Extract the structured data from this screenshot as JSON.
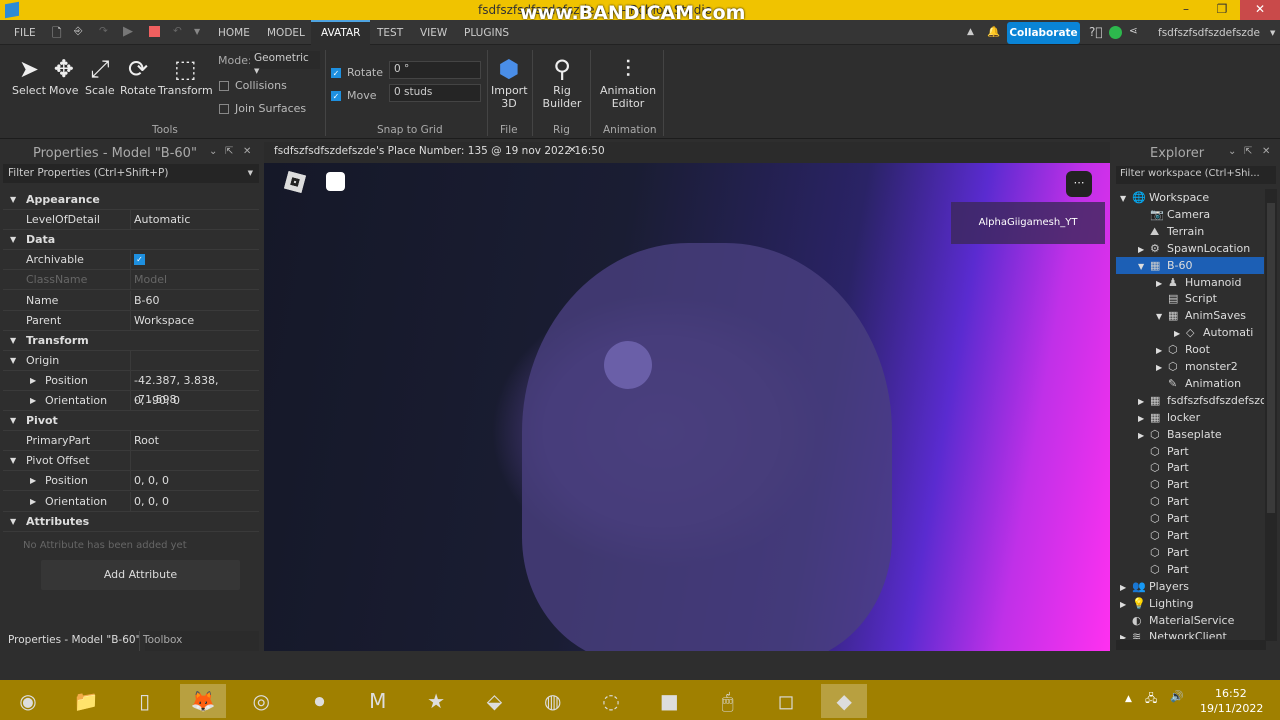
{
  "window": {
    "title": "fsdfszfsdfszdefszde - ... - Roblox Studio",
    "watermark": "www.BANDICAM.com",
    "min": "–",
    "max": "❐",
    "close": "✕"
  },
  "menu": {
    "file": "FILE",
    "tabs": [
      "HOME",
      "MODEL",
      "AVATAR",
      "TEST",
      "VIEW",
      "PLUGINS"
    ],
    "active": "AVATAR",
    "collaborate": "Collaborate",
    "user": "fsdfszfsdfszdefszde"
  },
  "ribbon": {
    "tools": [
      "Select",
      "Move",
      "Scale",
      "Rotate",
      "Transform"
    ],
    "mode_label": "Mode:",
    "mode_value": "Geometric",
    "collisions": "Collisions",
    "join_surfaces": "Join Surfaces",
    "tools_group": "Tools",
    "rotate_label": "Rotate",
    "rotate_value": "0 °",
    "move_label": "Move",
    "move_value": "0 studs",
    "snap_group": "Snap to Grid",
    "import": "Import 3D",
    "file_group": "File",
    "rig": "Rig Builder",
    "rig_group": "Rig",
    "anim": "Animation Editor",
    "anim_group": "Animation"
  },
  "properties": {
    "title": "Properties - Model \"B-60\"",
    "filter": "Filter Properties (Ctrl+Shift+P)",
    "rows": [
      {
        "k": "Appearance",
        "type": "section"
      },
      {
        "k": "LevelOfDetail",
        "v": "Automatic"
      },
      {
        "k": "Data",
        "type": "section"
      },
      {
        "k": "Archivable",
        "v": "✓",
        "type": "check"
      },
      {
        "k": "ClassName",
        "v": "Model",
        "type": "dim"
      },
      {
        "k": "Name",
        "v": "B-60"
      },
      {
        "k": "Parent",
        "v": "Workspace"
      },
      {
        "k": "Transform",
        "type": "section"
      },
      {
        "k": "Origin",
        "v": "",
        "type": "sub"
      },
      {
        "k": "Position",
        "v": "-42.387, 3.838, -71.598",
        "type": "child"
      },
      {
        "k": "Orientation",
        "v": "0, -90, 0",
        "type": "child"
      },
      {
        "k": "Pivot",
        "type": "section"
      },
      {
        "k": "PrimaryPart",
        "v": "Root"
      },
      {
        "k": "Pivot Offset",
        "v": "",
        "type": "sub"
      },
      {
        "k": "Position",
        "v": "0, 0, 0",
        "type": "child"
      },
      {
        "k": "Orientation",
        "v": "0, 0, 0",
        "type": "child"
      },
      {
        "k": "Attributes",
        "type": "section"
      }
    ],
    "no_attr": "No Attribute has been added yet",
    "add_attr": "Add Attribute"
  },
  "bottom_tabs": [
    "Properties - Model \"B-60\"",
    "Toolbox"
  ],
  "viewport": {
    "tab": "fsdfszfsdfszdefszde's Place Number: 135 @ 19 nov 2022 16:50",
    "player": "AlphaGiigamesh_YT"
  },
  "explorer": {
    "title": "Explorer",
    "filter": "Filter workspace (Ctrl+Shi...",
    "items": [
      {
        "name": "Workspace",
        "d": 0,
        "a": "▼",
        "i": "🌐"
      },
      {
        "name": "Camera",
        "d": 1,
        "a": "",
        "i": "📷"
      },
      {
        "name": "Terrain",
        "d": 1,
        "a": "",
        "i": "⛰"
      },
      {
        "name": "SpawnLocation",
        "d": 1,
        "a": "▶",
        "i": "⚙"
      },
      {
        "name": "B-60",
        "d": 1,
        "a": "▼",
        "i": "▦",
        "sel": true
      },
      {
        "name": "Humanoid",
        "d": 2,
        "a": "▶",
        "i": "♟"
      },
      {
        "name": "Script",
        "d": 2,
        "a": "",
        "i": "▤"
      },
      {
        "name": "AnimSaves",
        "d": 2,
        "a": "▼",
        "i": "▦"
      },
      {
        "name": "Automati",
        "d": 3,
        "a": "▶",
        "i": "◇"
      },
      {
        "name": "Root",
        "d": 2,
        "a": "▶",
        "i": "⬡"
      },
      {
        "name": "monster2",
        "d": 2,
        "a": "▶",
        "i": "⬡"
      },
      {
        "name": "Animation",
        "d": 2,
        "a": "",
        "i": "✎"
      },
      {
        "name": "fsdfszfsdfszdefszc",
        "d": 1,
        "a": "▶",
        "i": "▦"
      },
      {
        "name": "locker",
        "d": 1,
        "a": "▶",
        "i": "▦"
      },
      {
        "name": "Baseplate",
        "d": 1,
        "a": "▶",
        "i": "⬡"
      },
      {
        "name": "Part",
        "d": 1,
        "a": "",
        "i": "⬡"
      },
      {
        "name": "Part",
        "d": 1,
        "a": "",
        "i": "⬡"
      },
      {
        "name": "Part",
        "d": 1,
        "a": "",
        "i": "⬡"
      },
      {
        "name": "Part",
        "d": 1,
        "a": "",
        "i": "⬡"
      },
      {
        "name": "Part",
        "d": 1,
        "a": "",
        "i": "⬡"
      },
      {
        "name": "Part",
        "d": 1,
        "a": "",
        "i": "⬡"
      },
      {
        "name": "Part",
        "d": 1,
        "a": "",
        "i": "⬡"
      },
      {
        "name": "Part",
        "d": 1,
        "a": "",
        "i": "⬡"
      },
      {
        "name": "Players",
        "d": 0,
        "a": "▶",
        "i": "👥"
      },
      {
        "name": "Lighting",
        "d": 0,
        "a": "▶",
        "i": "💡"
      },
      {
        "name": "MaterialService",
        "d": 0,
        "a": "",
        "i": "◐"
      },
      {
        "name": "NetworkClient",
        "d": 0,
        "a": "▶",
        "i": "≋"
      }
    ]
  },
  "taskbar": {
    "apps": [
      "ie-icon",
      "file-explorer-icon",
      "notepad-icon",
      "firefox-icon",
      "chrome-icon",
      "record-icon",
      "m-icon",
      "star-icon",
      "app-icon",
      "sphere-icon",
      "obs-icon",
      "red-app-icon",
      "mouse-icon",
      "roblox-icon",
      "roblox-studio-icon"
    ],
    "time": "16:52",
    "date": "19/11/2022"
  }
}
